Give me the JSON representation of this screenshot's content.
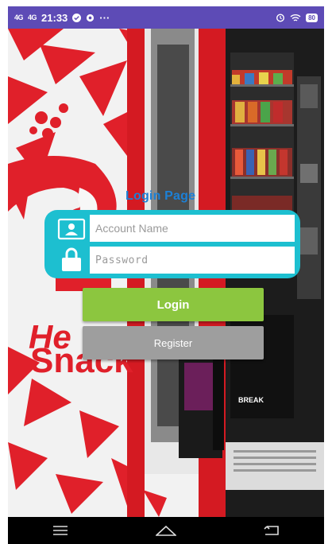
{
  "status_bar": {
    "network_1": "4G",
    "network_2": "4G",
    "time": "21:33",
    "more": "···",
    "battery": "80"
  },
  "background": {
    "brand_text_top": "He",
    "brand_text_bottom": "Snack",
    "vending_panel_text": "BREAK"
  },
  "login": {
    "title": "Login Page",
    "account_placeholder": "Account Name",
    "password_placeholder": "Password",
    "login_label": "Login",
    "register_label": "Register"
  },
  "colors": {
    "status_bar": "#5d4bb6",
    "card": "#1dbfd0",
    "login_button": "#8cc63f",
    "register_button": "#9e9e9e",
    "title": "#1c80d6",
    "brand_red": "#e0202a"
  },
  "icons": {
    "account": "person-card-icon",
    "password": "lock-icon",
    "nav_menu": "menu-icon",
    "nav_home": "home-icon",
    "nav_back": "back-icon"
  }
}
